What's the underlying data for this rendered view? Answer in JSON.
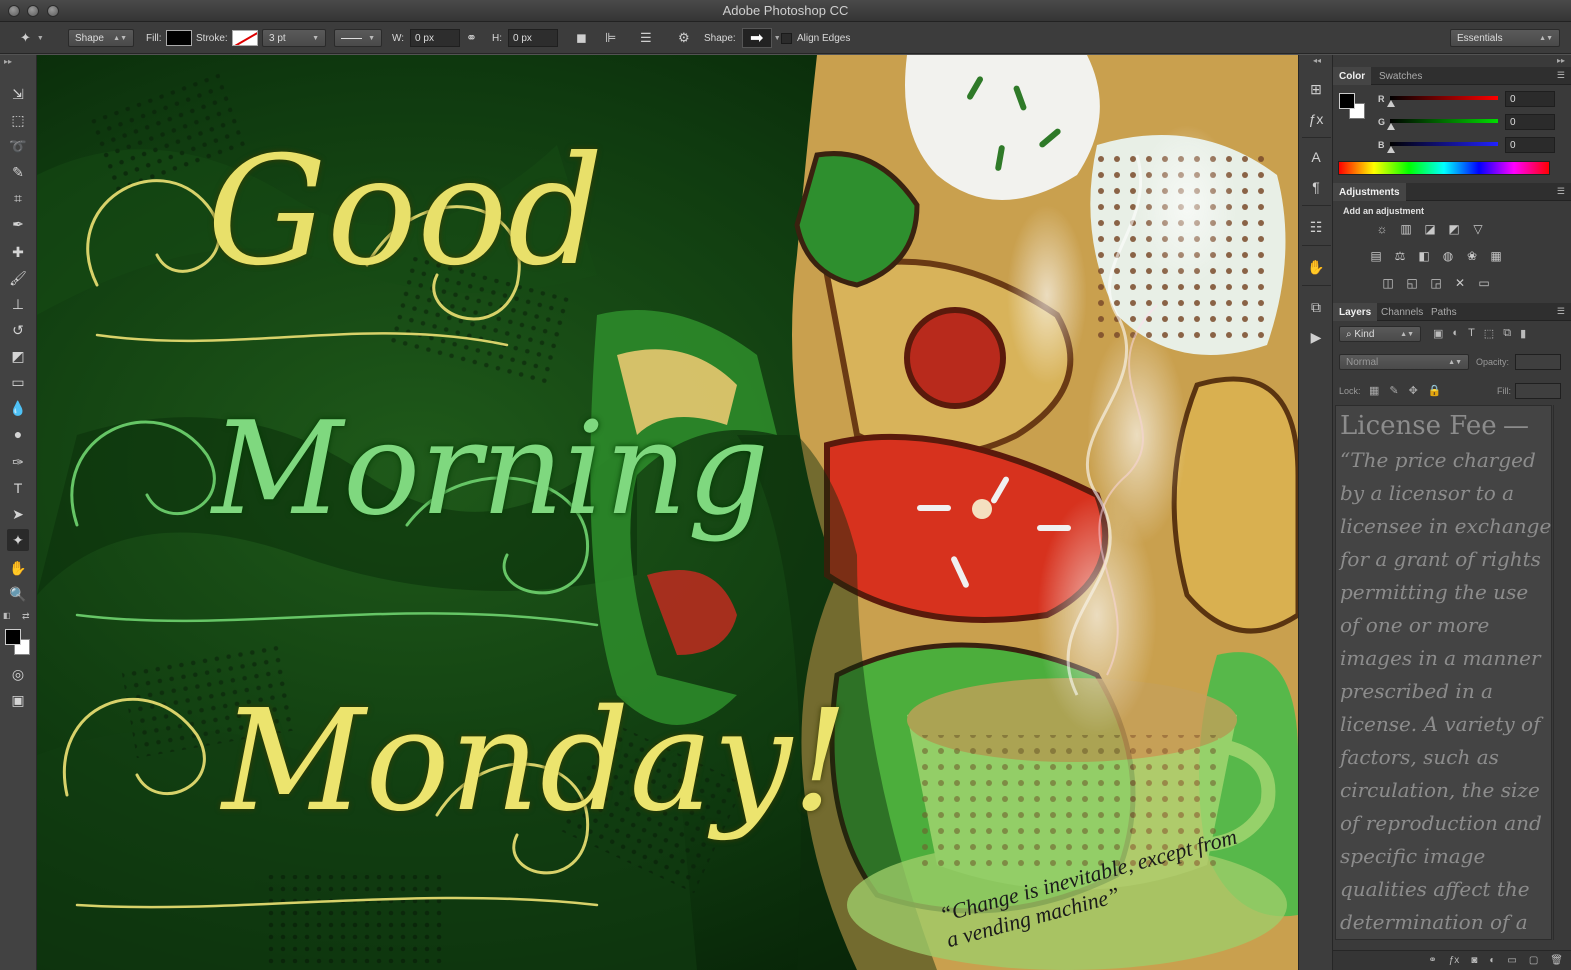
{
  "window": {
    "title": "Adobe Photoshop CC"
  },
  "options_bar": {
    "tool_mode": "Shape",
    "fill_label": "Fill:",
    "stroke_label": "Stroke:",
    "stroke_width": "3 pt",
    "w_label": "W:",
    "w_value": "0 px",
    "h_label": "H:",
    "h_value": "0 px",
    "shape_label": "Shape:",
    "align_edges_label": "Align Edges",
    "workspace": "Essentials"
  },
  "toolbox": {
    "tools": [
      "move-tool",
      "marquee-tool",
      "lasso-tool",
      "quick-selection-tool",
      "crop-tool",
      "eyedropper-tool",
      "healing-brush-tool",
      "brush-tool",
      "clone-stamp-tool",
      "history-brush-tool",
      "eraser-tool",
      "gradient-tool",
      "blur-tool",
      "dodge-tool",
      "pen-tool",
      "type-tool",
      "path-selection-tool",
      "custom-shape-tool",
      "hand-tool",
      "zoom-tool"
    ]
  },
  "color_panel": {
    "tabs": [
      "Color",
      "Swatches"
    ],
    "r_label": "R",
    "r_value": "0",
    "g_label": "G",
    "g_value": "0",
    "b_label": "B",
    "b_value": "0"
  },
  "adjustments_panel": {
    "tab": "Adjustments",
    "heading": "Add an adjustment"
  },
  "layers_panel": {
    "tabs": [
      "Layers",
      "Channels",
      "Paths"
    ],
    "filter_kind": "Kind",
    "blend_mode": "Normal",
    "opacity_label": "Opacity:",
    "lock_label": "Lock:",
    "fill_label": "Fill:"
  },
  "license_text": {
    "title": "License Fee",
    "dash": "—",
    "body": "“The price charged by a licensor to a licensee in exchange for a grant of rights permitting the use of one or more images in a manner prescribed in a license. A variety of factors, such as circulation, the size of reproduction and specific image qualities affect the determination of a particular license fee”"
  },
  "canvas": {
    "greeting_words": [
      "Good",
      "Morning",
      "Monday!"
    ],
    "quote": "“Change is inevitable, except from a vending machine”"
  },
  "colors": {
    "app_bg": "#535353",
    "accent_green": "#2fa02f",
    "letter_yellow": "#e8e06a",
    "letter_green": "#6fd16f"
  }
}
